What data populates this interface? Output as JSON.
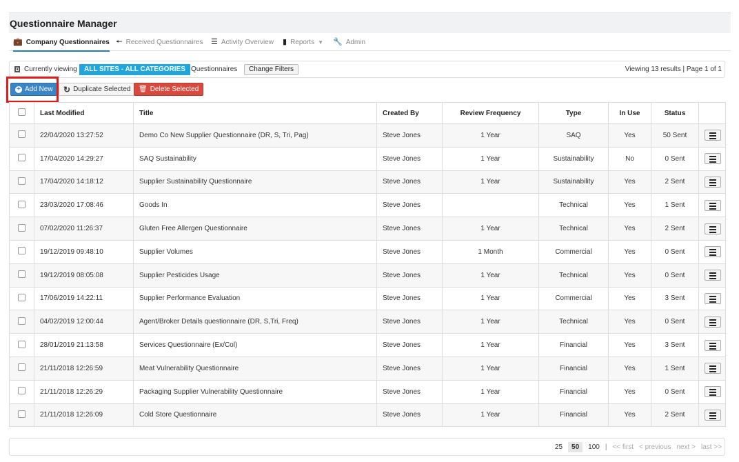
{
  "app": {
    "title": "Questionnaire Manager"
  },
  "nav": {
    "items": [
      {
        "label": "Company Questionnaires",
        "icon": "briefcase-icon"
      },
      {
        "label": "Received Questionnaires",
        "icon": "arrow-left-icon"
      },
      {
        "label": "Activity Overview",
        "icon": "list-icon"
      },
      {
        "label": "Reports",
        "icon": "file-icon"
      },
      {
        "label": "Admin",
        "icon": "wrench-icon"
      }
    ]
  },
  "filter": {
    "prefix": "Currently viewing",
    "pill": "ALL SITES - ALL CATEGORIES",
    "suffix": "Questionnaires",
    "change_label": "Change Filters",
    "results": "Viewing 13 results | Page 1 of 1"
  },
  "toolbar": {
    "add_new": "Add New",
    "duplicate": "Duplicate Selected",
    "delete": "Delete Selected"
  },
  "table": {
    "headers": [
      "Last Modified",
      "Title",
      "Created By",
      "Review Frequency",
      "Type",
      "In Use",
      "Status"
    ],
    "rows": [
      {
        "modified": "22/04/2020 13:27:52",
        "title": "Demo Co New Supplier Questionnaire (DR, S, Tri, Pag)",
        "created_by": "Steve Jones",
        "frequency": "1 Year",
        "type": "SAQ",
        "in_use": "Yes",
        "status": "50 Sent"
      },
      {
        "modified": "17/04/2020 14:29:27",
        "title": "SAQ Sustainability",
        "created_by": "Steve Jones",
        "frequency": "1 Year",
        "type": "Sustainability",
        "in_use": "No",
        "status": "0 Sent"
      },
      {
        "modified": "17/04/2020 14:18:12",
        "title": "Supplier Sustainability Questionnaire",
        "created_by": "Steve Jones",
        "frequency": "1 Year",
        "type": "Sustainability",
        "in_use": "Yes",
        "status": "2 Sent"
      },
      {
        "modified": "23/03/2020 17:08:46",
        "title": "Goods In",
        "created_by": "Steve Jones",
        "frequency": "",
        "type": "Technical",
        "in_use": "Yes",
        "status": "1 Sent"
      },
      {
        "modified": "07/02/2020 11:26:37",
        "title": "Gluten Free Allergen Questionnaire",
        "created_by": "Steve Jones",
        "frequency": "1 Year",
        "type": "Technical",
        "in_use": "Yes",
        "status": "2 Sent"
      },
      {
        "modified": "19/12/2019 09:48:10",
        "title": "Supplier Volumes",
        "created_by": "Steve Jones",
        "frequency": "1 Month",
        "type": "Commercial",
        "in_use": "Yes",
        "status": "0 Sent"
      },
      {
        "modified": "19/12/2019 08:05:08",
        "title": "Supplier Pesticides Usage",
        "created_by": "Steve Jones",
        "frequency": "1 Year",
        "type": "Technical",
        "in_use": "Yes",
        "status": "0 Sent"
      },
      {
        "modified": "17/06/2019 14:22:11",
        "title": "Supplier Performance Evaluation",
        "created_by": "Steve Jones",
        "frequency": "1 Year",
        "type": "Commercial",
        "in_use": "Yes",
        "status": "3 Sent"
      },
      {
        "modified": "04/02/2019 12:00:44",
        "title": "Agent/Broker Details questionnaire (DR, S,Tri, Freq)",
        "created_by": "Steve Jones",
        "frequency": "1 Year",
        "type": "Technical",
        "in_use": "Yes",
        "status": "0 Sent"
      },
      {
        "modified": "28/01/2019 21:13:58",
        "title": "Services Questionnaire (Ex/Col)",
        "created_by": "Steve Jones",
        "frequency": "1 Year",
        "type": "Financial",
        "in_use": "Yes",
        "status": "3 Sent"
      },
      {
        "modified": "21/11/2018 12:26:59",
        "title": "Meat Vulnerability Questionnaire",
        "created_by": "Steve Jones",
        "frequency": "1 Year",
        "type": "Financial",
        "in_use": "Yes",
        "status": "1 Sent"
      },
      {
        "modified": "21/11/2018 12:26:29",
        "title": "Packaging Supplier Vulnerability Questionnaire",
        "created_by": "Steve Jones",
        "frequency": "1 Year",
        "type": "Financial",
        "in_use": "Yes",
        "status": "0 Sent"
      },
      {
        "modified": "21/11/2018 12:26:09",
        "title": "Cold Store Questionnaire",
        "created_by": "Steve Jones",
        "frequency": "1 Year",
        "type": "Financial",
        "in_use": "Yes",
        "status": "2 Sent"
      }
    ]
  },
  "pager": {
    "sizes": [
      "25",
      "50",
      "100"
    ],
    "active_size": "50",
    "separator": "|",
    "first": "<< first",
    "previous": "< previous",
    "next": "next >",
    "last": "last >>"
  },
  "colors": {
    "accent": "#1ea6dd",
    "primary": "#3a85c6",
    "danger": "#d64a3f",
    "highlight": "#e01b1b"
  }
}
